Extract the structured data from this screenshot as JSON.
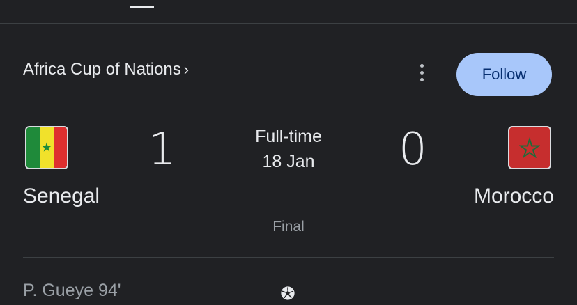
{
  "competition": {
    "name": "Africa Cup of Nations",
    "chevron": "›"
  },
  "actions": {
    "follow_label": "Follow",
    "more_icon": "more-vert-icon"
  },
  "match": {
    "status": "Full-time",
    "date": "18 Jan",
    "round": "Final",
    "home": {
      "name": "Senegal",
      "score": "1",
      "flag_colors": [
        "#1f8a3a",
        "#f1e12b",
        "#de2f2f"
      ]
    },
    "away": {
      "name": "Morocco",
      "score": "0",
      "flag_colors": [
        "#c62e2e",
        "#1f6b3a"
      ]
    }
  },
  "events": [
    {
      "player": "P. Gueye 94'",
      "icon": "soccer-ball-icon"
    }
  ],
  "colors": {
    "background": "#202124",
    "follow_button": "#a8c7fa",
    "divider": "#3c4043"
  }
}
